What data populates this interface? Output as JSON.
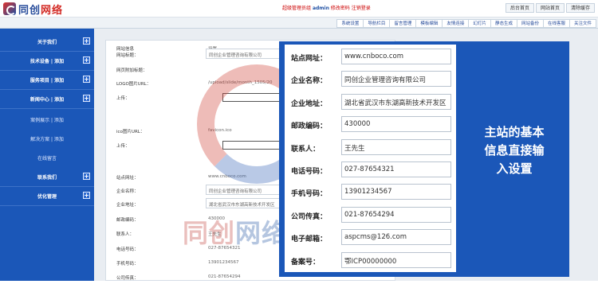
{
  "header": {
    "logo_text_a": "同创",
    "logo_text_b": "网络",
    "welcome_prefix": "超级管理员组",
    "username": "admin",
    "change_password": "修改密码",
    "logout": "注销登录",
    "right_buttons": [
      "后台首页",
      "网站首页",
      "清除缓存"
    ]
  },
  "navbar": {
    "tabs": [
      "系统设置",
      "导航栏目",
      "留言管理",
      "模板编辑",
      "友情连接",
      "幻灯片",
      "静态生成",
      "网站备份",
      "在线客服",
      "关注文件"
    ]
  },
  "sidebar": {
    "items": [
      {
        "label": "关于我们",
        "sub": false,
        "plus": true
      },
      {
        "label": "技术设备 | 添加",
        "sub": false,
        "plus": true
      },
      {
        "label": "服务项目 | 添加",
        "sub": false,
        "plus": true
      },
      {
        "label": "新闻中心 | 添加",
        "sub": false,
        "plus": true
      },
      {
        "label": "案例展示 | 添加",
        "sub": true,
        "plus": false
      },
      {
        "label": "解决方案 | 添加",
        "sub": true,
        "plus": false
      },
      {
        "label": "在线留言",
        "sub": true,
        "plus": false
      },
      {
        "label": "联系我们",
        "sub": false,
        "plus": true
      },
      {
        "label": "优化管理",
        "sub": false,
        "plus": true
      }
    ]
  },
  "form": {
    "header_label": "网站信息",
    "header_value": "设置",
    "rows": [
      {
        "label": "网站标题：",
        "value": "同创企业管理咨询有限公司",
        "type": "box"
      },
      {
        "label": "网页附加标题：",
        "value": "",
        "type": "text"
      },
      {
        "label": "LOGO图片URL：",
        "value": "/upload/slide/month_1505/20",
        "type": "text"
      },
      {
        "label": "上传：",
        "value": "",
        "type": "upload"
      },
      {
        "label": "ico图片URL：",
        "value": "favicon.ico",
        "type": "text"
      },
      {
        "label": "上传：",
        "value": "",
        "type": "upload"
      },
      {
        "label": "站点网址：",
        "value": "www.cnboco.com",
        "type": "text"
      },
      {
        "label": "企业名称：",
        "value": "同创企业管理咨询有限公司",
        "type": "box"
      },
      {
        "label": "企业地址：",
        "value": "湖北省武汉市东湖高新技术开发区",
        "type": "box"
      },
      {
        "label": "邮政编码：",
        "value": "430000",
        "type": "text"
      },
      {
        "label": "联系人：",
        "value": "王先生",
        "type": "text"
      },
      {
        "label": "电话号码：",
        "value": "027-87654321",
        "type": "text"
      },
      {
        "label": "手机号码：",
        "value": "13901234567",
        "type": "text"
      },
      {
        "label": "公司传真：",
        "value": "021-87654294",
        "type": "text"
      }
    ]
  },
  "watermark": {
    "text_a": "同创",
    "text_b": "网络"
  },
  "callout": {
    "rows": [
      {
        "label": "站点网址：",
        "value": "www.cnboco.com"
      },
      {
        "label": "企业名称：",
        "value": "同创企业管理咨询有限公司"
      },
      {
        "label": "企业地址：",
        "value": "湖北省武汉市东湖高新技术开发区"
      },
      {
        "label": "邮政编码：",
        "value": "430000"
      },
      {
        "label": "联系人：",
        "value": "王先生"
      },
      {
        "label": "电话号码：",
        "value": "027-87654321"
      },
      {
        "label": "手机号码：",
        "value": "13901234567"
      },
      {
        "label": "公司传真：",
        "value": "021-87654294"
      },
      {
        "label": "电子邮箱：",
        "value": "aspcms@126.com"
      },
      {
        "label": "备案号：",
        "value": "鄂ICP00000000"
      }
    ],
    "caption_lines": [
      "主站的基本",
      "信息直接输",
      "入设置"
    ]
  },
  "colors": {
    "brand_blue": "#1b57b8",
    "brand_red": "#d32b25"
  }
}
